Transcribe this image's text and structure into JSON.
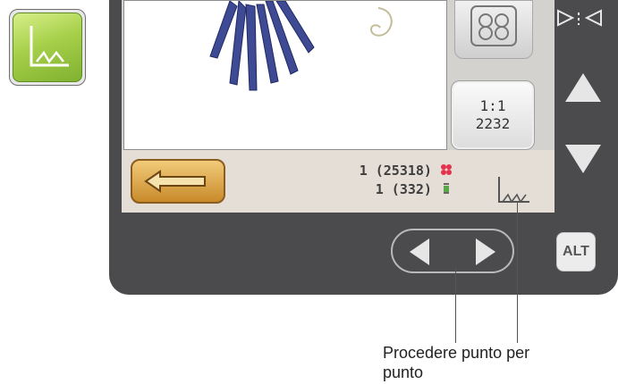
{
  "callout": {
    "caption_line1": "Procedere punto per",
    "caption_line2": "punto"
  },
  "screen": {
    "counter_top": "1:1",
    "counter_bottom": "2232",
    "stat_line_1_value": "1 (25318)",
    "stat_line_2_value": "1 (332)"
  },
  "keys": {
    "alt_label": "ALT"
  },
  "colors": {
    "panel": "#4b4b4d",
    "screen_bar": "#e4ded6",
    "back_button_gold": "#d7a341",
    "stitch_tile_green": "#9ccc45",
    "embroidery_blue": "#3e4a93",
    "stat_icon_red": "#e5334f",
    "stat_icon_green": "#58a84b"
  },
  "icons": {
    "stitch_tile": "stitch-type-icon",
    "back_button": "return-arrow-icon",
    "stitch_mode": "stitch-mode-icon",
    "stat_line_1": "color-block-icon",
    "stat_line_2": "thread-spool-icon",
    "top_right": "play-stop-icon",
    "up": "arrow-up-icon",
    "down": "arrow-down-icon",
    "prev": "arrow-left-icon",
    "next": "arrow-right-icon"
  }
}
